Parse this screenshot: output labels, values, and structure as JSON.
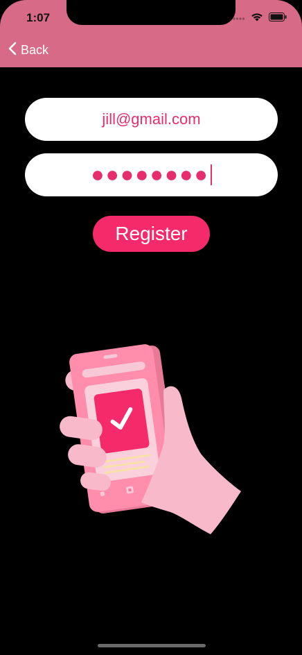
{
  "status_bar": {
    "time": "1:07"
  },
  "nav": {
    "back_label": "Back"
  },
  "form": {
    "email_value": "jill@gmail.com",
    "password_masked": "●●●●●●●●",
    "register_label": "Register"
  },
  "colors": {
    "header": "#D76A87",
    "accent": "#F42A6B",
    "text_pink": "#E62E6E",
    "background": "#000000"
  },
  "icons": {
    "back": "chevron-left-icon",
    "signal": "cellular-signal-icon",
    "wifi": "wifi-icon",
    "battery": "battery-icon",
    "illustration": "phone-checkmark-illustration"
  }
}
